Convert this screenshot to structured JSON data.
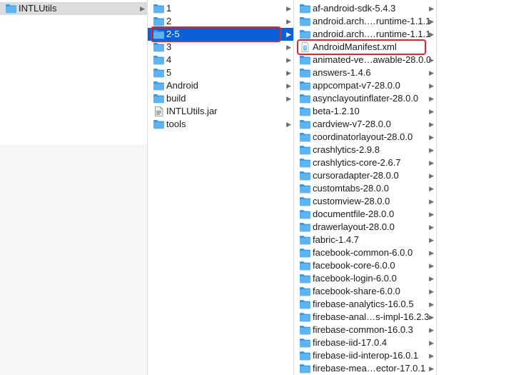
{
  "colors": {
    "folder": "#5eb4f0",
    "folder_tab": "#3e98dd",
    "selection_blue": "#0961d9",
    "selection_grey": "#dcdcdc",
    "highlight_red": "#e3262e"
  },
  "columns": [
    {
      "items": [
        {
          "label": "INTLUtils",
          "icon": "folder-icon",
          "chevron": true,
          "state": "selected-inactive"
        }
      ]
    },
    {
      "items": [
        {
          "label": "1",
          "icon": "folder-icon",
          "chevron": true
        },
        {
          "label": "2",
          "icon": "folder-icon",
          "chevron": true
        },
        {
          "label": "2-5",
          "icon": "folder-icon",
          "chevron": true,
          "state": "selected-active",
          "highlighted": true
        },
        {
          "label": "3",
          "icon": "folder-icon",
          "chevron": true
        },
        {
          "label": "4",
          "icon": "folder-icon",
          "chevron": true
        },
        {
          "label": "5",
          "icon": "folder-icon",
          "chevron": true
        },
        {
          "label": "Android",
          "icon": "folder-icon",
          "chevron": true
        },
        {
          "label": "build",
          "icon": "folder-icon",
          "chevron": true
        },
        {
          "label": "INTLUtils.jar",
          "icon": "jar-file-icon",
          "chevron": false
        },
        {
          "label": "tools",
          "icon": "folder-icon",
          "chevron": true
        }
      ]
    },
    {
      "items": [
        {
          "label": "af-android-sdk-5.4.3",
          "icon": "folder-icon",
          "chevron": true
        },
        {
          "label": "android.arch.…runtime-1.1.1",
          "icon": "folder-icon",
          "chevron": true
        },
        {
          "label": "android.arch.…runtime-1.1.1",
          "icon": "folder-icon",
          "chevron": true
        },
        {
          "label": "AndroidManifest.xml",
          "icon": "xml-file-icon",
          "chevron": false,
          "highlighted": true
        },
        {
          "label": "animated-ve…awable-28.0.0",
          "icon": "folder-icon",
          "chevron": true
        },
        {
          "label": "answers-1.4.6",
          "icon": "folder-icon",
          "chevron": true
        },
        {
          "label": "appcompat-v7-28.0.0",
          "icon": "folder-icon",
          "chevron": true
        },
        {
          "label": "asynclayoutinflater-28.0.0",
          "icon": "folder-icon",
          "chevron": true
        },
        {
          "label": "beta-1.2.10",
          "icon": "folder-icon",
          "chevron": true
        },
        {
          "label": "cardview-v7-28.0.0",
          "icon": "folder-icon",
          "chevron": true
        },
        {
          "label": "coordinatorlayout-28.0.0",
          "icon": "folder-icon",
          "chevron": true
        },
        {
          "label": "crashlytics-2.9.8",
          "icon": "folder-icon",
          "chevron": true
        },
        {
          "label": "crashlytics-core-2.6.7",
          "icon": "folder-icon",
          "chevron": true
        },
        {
          "label": "cursoradapter-28.0.0",
          "icon": "folder-icon",
          "chevron": true
        },
        {
          "label": "customtabs-28.0.0",
          "icon": "folder-icon",
          "chevron": true
        },
        {
          "label": "customview-28.0.0",
          "icon": "folder-icon",
          "chevron": true
        },
        {
          "label": "documentfile-28.0.0",
          "icon": "folder-icon",
          "chevron": true
        },
        {
          "label": "drawerlayout-28.0.0",
          "icon": "folder-icon",
          "chevron": true
        },
        {
          "label": "fabric-1.4.7",
          "icon": "folder-icon",
          "chevron": true
        },
        {
          "label": "facebook-common-6.0.0",
          "icon": "folder-icon",
          "chevron": true
        },
        {
          "label": "facebook-core-6.0.0",
          "icon": "folder-icon",
          "chevron": true
        },
        {
          "label": "facebook-login-6.0.0",
          "icon": "folder-icon",
          "chevron": true
        },
        {
          "label": "facebook-share-6.0.0",
          "icon": "folder-icon",
          "chevron": true
        },
        {
          "label": "firebase-analytics-16.0.5",
          "icon": "folder-icon",
          "chevron": true
        },
        {
          "label": "firebase-anal…s-impl-16.2.3",
          "icon": "folder-icon",
          "chevron": true
        },
        {
          "label": "firebase-common-16.0.3",
          "icon": "folder-icon",
          "chevron": true
        },
        {
          "label": "firebase-iid-17.0.4",
          "icon": "folder-icon",
          "chevron": true
        },
        {
          "label": "firebase-iid-interop-16.0.1",
          "icon": "folder-icon",
          "chevron": true
        },
        {
          "label": "firebase-mea…ector-17.0.1",
          "icon": "folder-icon",
          "chevron": true
        }
      ]
    }
  ]
}
